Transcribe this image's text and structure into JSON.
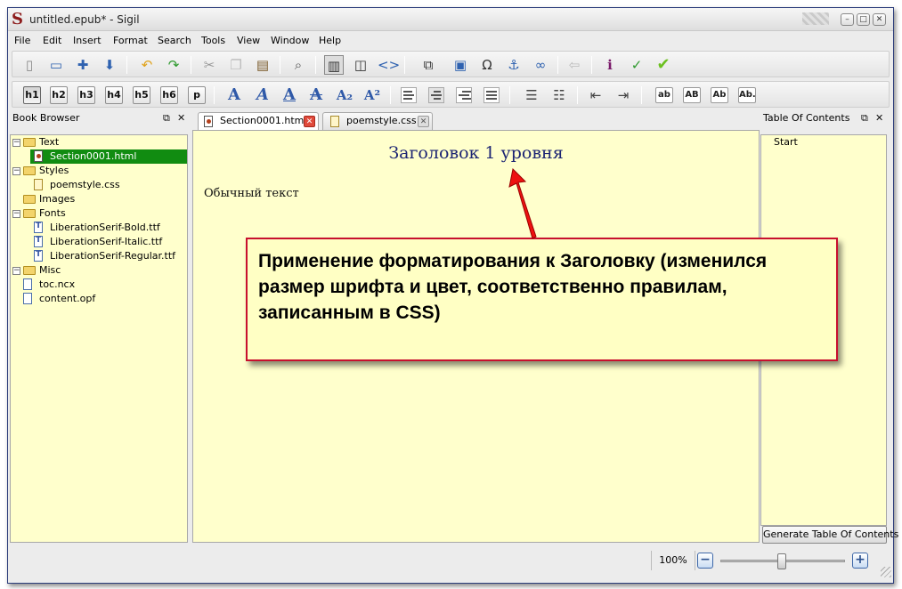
{
  "window": {
    "title": "untitled.epub* - Sigil",
    "logo": "S"
  },
  "menu": [
    "File",
    "Edit",
    "Insert",
    "Format",
    "Search",
    "Tools",
    "View",
    "Window",
    "Help"
  ],
  "heading_buttons": [
    "h1",
    "h2",
    "h3",
    "h4",
    "h5",
    "h6",
    "p"
  ],
  "case_buttons": [
    "ab",
    "AB",
    "Ab",
    "Ab."
  ],
  "book_browser": {
    "title": "Book Browser",
    "items": [
      {
        "label": "Text",
        "kind": "folder"
      },
      {
        "label": "Section0001.html",
        "kind": "html"
      },
      {
        "label": "Styles",
        "kind": "folder"
      },
      {
        "label": "poemstyle.css",
        "kind": "css"
      },
      {
        "label": "Images",
        "kind": "folder"
      },
      {
        "label": "Fonts",
        "kind": "folder"
      },
      {
        "label": "LiberationSerif-Bold.ttf",
        "kind": "font"
      },
      {
        "label": "LiberationSerif-Italic.ttf",
        "kind": "font"
      },
      {
        "label": "LiberationSerif-Regular.ttf",
        "kind": "font"
      },
      {
        "label": "Misc",
        "kind": "folder"
      },
      {
        "label": "toc.ncx",
        "kind": "file"
      },
      {
        "label": "content.opf",
        "kind": "file"
      }
    ]
  },
  "tabs": [
    {
      "label": "Section0001.html",
      "active": true
    },
    {
      "label": "poemstyle.css",
      "active": false
    }
  ],
  "document": {
    "heading": "Заголовок 1 уровня",
    "paragraph": "Обычный текст"
  },
  "toc": {
    "title": "Table Of Contents",
    "entries": [
      "Start"
    ],
    "generate_button": "Generate Table Of Contents"
  },
  "status": {
    "zoom": "100%",
    "zoom_minus": "−",
    "zoom_plus": "+"
  },
  "callout": {
    "text": "Применение форматирования к Заголовку (изменился размер шрифта и цвет, соответственно правилам, записанным в CSS)"
  },
  "icons": {
    "close": "✕",
    "float": "⧉",
    "minimize": "–",
    "maximize": "□",
    "tree_open": "−"
  },
  "colors": {
    "pane_background": "#ffffcc",
    "selection": "#118c11",
    "heading": "#1c2473",
    "callout_border": "#c8102e"
  }
}
